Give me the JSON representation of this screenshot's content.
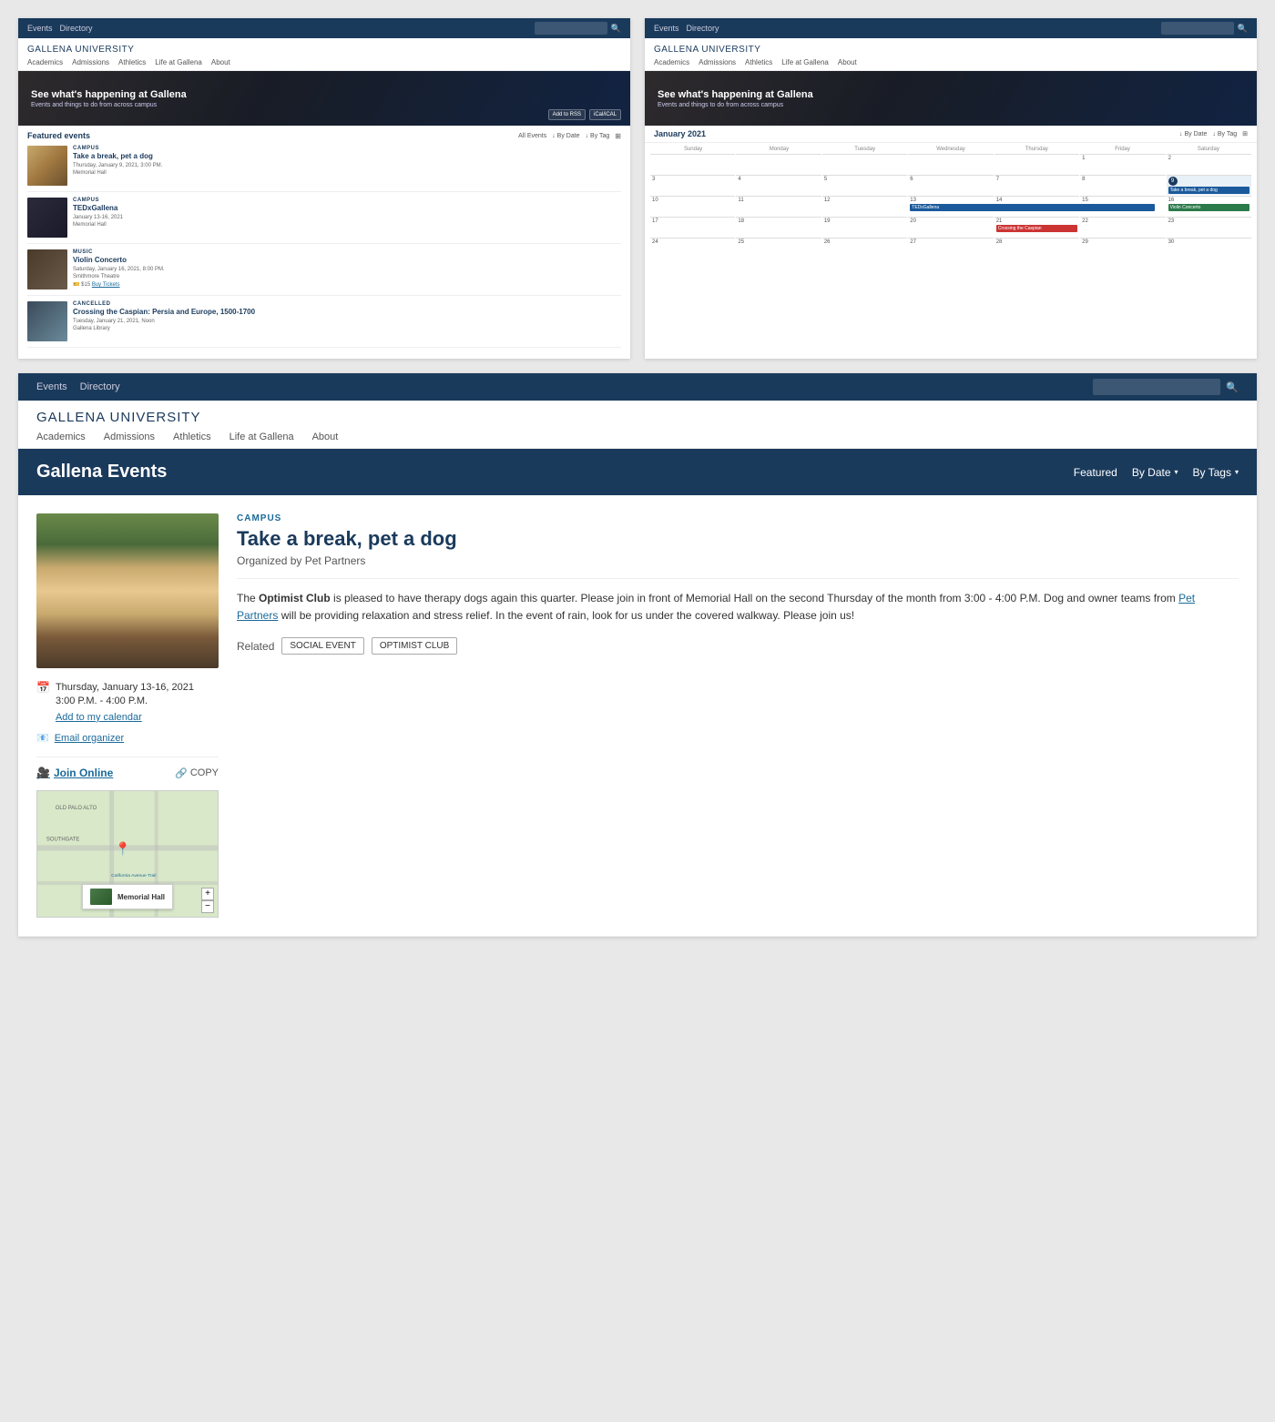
{
  "topLeft": {
    "navLinks": [
      "Events",
      "Directory"
    ],
    "searchPlaceholder": "",
    "logo": "GALLENA",
    "logoSuffix": " UNIVERSITY",
    "navItems": [
      "Academics",
      "Admissions",
      "Athletics",
      "Life at Gallena",
      "About"
    ],
    "heroTitle": "See what's happening at Gallena",
    "heroSub": "Events and things to do from across campus",
    "heroBtnAdd": "Add to RSS",
    "heroBtnCalendar": "iCal/iCAL",
    "eventsTitle": "Featured events",
    "filterAll": "All Events",
    "filterDate": "↓ By Date",
    "filterTag": "↓ By Tag",
    "events": [
      {
        "category": "CAMPUS",
        "name": "Take a break, pet a dog",
        "date": "Thursday, January 9, 2021, 3:00 PM.",
        "location": "Memorial Hall",
        "thumb": "dog",
        "cancelled": false
      },
      {
        "category": "CAMPUS",
        "name": "TEDxGallena",
        "date": "January 13-16, 2021",
        "location": "Memorial Hall",
        "thumb": "talk",
        "cancelled": false
      },
      {
        "category": "MUSIC",
        "name": "Violin Concerto",
        "date": "Saturday, January 16, 2021, 8:00 PM.",
        "location": "Smithmore Theatre",
        "price": "$15",
        "priceLink": "Buy Tickets",
        "thumb": "violin",
        "cancelled": false
      },
      {
        "category": "CANCELLED",
        "name": "Crossing the Caspian: Persia and Europe, 1500-1700",
        "date": "Tuesday, January 21, 2021, Noon",
        "location": "Gallena Library",
        "thumb": "carpet",
        "cancelled": true
      }
    ]
  },
  "topRight": {
    "navLinks": [
      "Events",
      "Directory"
    ],
    "logo": "GALLENA",
    "logoSuffix": " UNIVERSITY",
    "navItems": [
      "Academics",
      "Admissions",
      "Athletics",
      "Life at Gallena",
      "About"
    ],
    "heroTitle": "See what's happening at Gallena",
    "heroSub": "Events and things to do from across campus",
    "calMonth": "January 2021",
    "filterDate": "↓ By Date",
    "filterTag": "↓ By Tag",
    "dayHeaders": [
      "Sunday",
      "Monday",
      "Tuesday",
      "Wednesday",
      "Thursday",
      "Friday",
      "Saturday"
    ],
    "weeks": [
      [
        {
          "num": "",
          "events": []
        },
        {
          "num": "",
          "events": []
        },
        {
          "num": "",
          "events": []
        },
        {
          "num": "",
          "events": []
        },
        {
          "num": "",
          "events": []
        },
        {
          "num": "1",
          "events": []
        },
        {
          "num": "2",
          "events": []
        }
      ],
      [
        {
          "num": "3",
          "events": []
        },
        {
          "num": "4",
          "events": []
        },
        {
          "num": "5",
          "events": []
        },
        {
          "num": "6",
          "events": []
        },
        {
          "num": "7",
          "events": []
        },
        {
          "num": "8",
          "events": []
        },
        {
          "num": "9",
          "events": [
            {
              "label": "Take a break, pet a dog",
              "color": "blue"
            }
          ]
        }
      ],
      [
        {
          "num": "10",
          "events": []
        },
        {
          "num": "11",
          "events": []
        },
        {
          "num": "12",
          "events": []
        },
        {
          "num": "13",
          "events": [
            {
              "label": "TEDxGallena",
              "color": "blue",
              "span": 4
            }
          ]
        },
        {
          "num": "14",
          "events": []
        },
        {
          "num": "15",
          "events": []
        },
        {
          "num": "16",
          "events": [
            {
              "label": "Violin Concerto",
              "color": "green"
            }
          ]
        }
      ],
      [
        {
          "num": "17",
          "events": []
        },
        {
          "num": "18",
          "events": []
        },
        {
          "num": "19",
          "events": []
        },
        {
          "num": "20",
          "events": []
        },
        {
          "num": "21",
          "events": [
            {
              "label": "Crossing the Caspian",
              "color": "red"
            }
          ]
        },
        {
          "num": "22",
          "events": []
        },
        {
          "num": "23",
          "events": []
        }
      ],
      [
        {
          "num": "24",
          "events": []
        },
        {
          "num": "25",
          "events": []
        },
        {
          "num": "26",
          "events": []
        },
        {
          "num": "27",
          "events": []
        },
        {
          "num": "28",
          "events": []
        },
        {
          "num": "29",
          "events": []
        },
        {
          "num": "30",
          "events": []
        }
      ]
    ]
  },
  "bottom": {
    "navLinks": [
      "Events",
      "Directory"
    ],
    "logo": "GALLENA",
    "logoSuffix": " UNIVERSITY",
    "navItems": [
      "Academics",
      "Admissions",
      "Athletics",
      "Life at Gallena",
      "About"
    ],
    "bannerTitle": "Gallena Events",
    "filterFeatured": "Featured",
    "filterByDate": "By Date",
    "filterByTags": "By Tags",
    "eventCategory": "CAMPUS",
    "eventTitle": "Take a break, pet a dog",
    "eventOrganizer": "Organized by Pet Partners",
    "eventDescription": "The Optimist Club is pleased to have therapy dogs again this quarter. Please join in front of Memorial Hall on the second Thursday of the month from 3:00 - 4:00 P.M. Dog and owner teams from Pet Partners will be providing relaxation and stress relief. In the event of rain, look for us under the covered walkway. Please join us!",
    "petPartnersLink": "Pet Partners",
    "relatedLabel": "Related",
    "relatedTags": [
      "SOCIAL EVENT",
      "OPTIMIST CLUB"
    ],
    "dateLabel": "Thursday, January 13-16, 2021",
    "timeLabel": "3:00 P.M. - 4:00 P.M.",
    "addCalLink": "Add to my calendar",
    "emailLink": "Email organizer",
    "joinOnlineLink": "Join Online",
    "copyBtn": "COPY",
    "mapCaption": "Memorial Hall",
    "mapLabels": [
      "OLD PALO ALTO",
      "SOUTHGATE"
    ],
    "mapPlusBtn": "+",
    "mapMinusBtn": "−"
  }
}
